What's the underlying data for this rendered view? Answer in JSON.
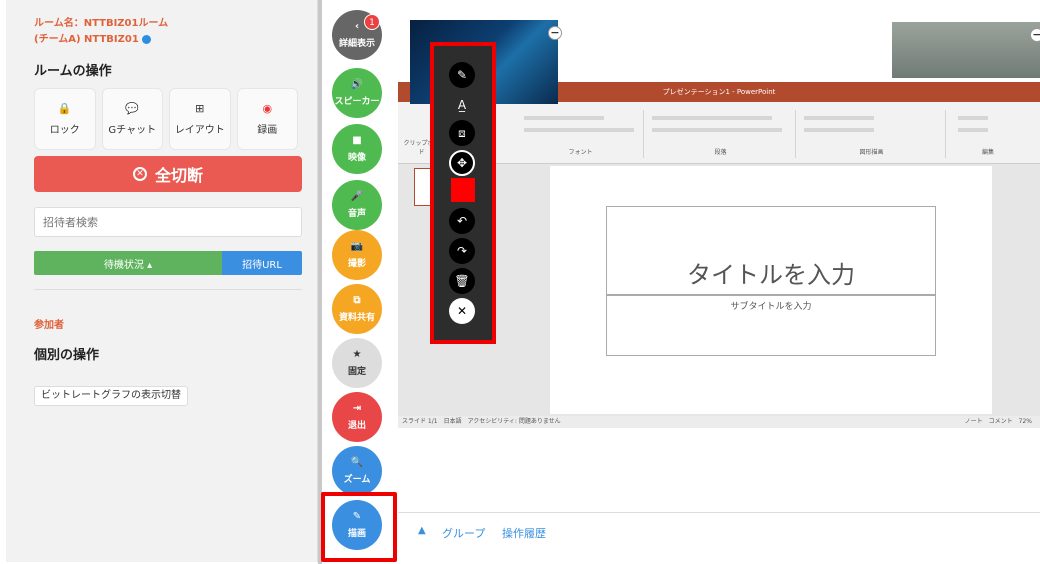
{
  "room": {
    "name_line1": "ルーム名：NTTBIZ01ルーム",
    "name_line2": "(チームA) NTTBIZ01",
    "ops_title": "ルームの操作",
    "ops": [
      {
        "icon": "lock-icon",
        "glyph": "🔒",
        "label": "ロック"
      },
      {
        "icon": "chat-icon",
        "glyph": "💬",
        "label": "Gチャット"
      },
      {
        "icon": "layout-icon",
        "glyph": "⊞",
        "label": "レイアウト"
      },
      {
        "icon": "record-icon",
        "glyph": "◉",
        "label": "録画"
      }
    ],
    "disconnect_label": "全切断",
    "search_placeholder": "招待者検索",
    "waiting_label": "待機状況 ▴",
    "invite_url_label": "招待URL",
    "participants_label": "参加者",
    "individual_ops_title": "個別の操作",
    "bitrate_toggle_label": "ビットレートグラフの表示切替"
  },
  "rail": {
    "badge_count": "1",
    "buttons": [
      {
        "name": "details",
        "icon": "chevron-left-icon",
        "glyph": "‹",
        "label": "詳細表示"
      },
      {
        "name": "speaker",
        "icon": "speaker-icon",
        "glyph": "🔊",
        "label": "スピーカー"
      },
      {
        "name": "video",
        "icon": "video-icon",
        "glyph": "■",
        "label": "映像"
      },
      {
        "name": "audio",
        "icon": "microphone-icon",
        "glyph": "🎤",
        "label": "音声"
      },
      {
        "name": "photo",
        "icon": "camera-icon",
        "glyph": "📷",
        "label": "撮影"
      },
      {
        "name": "share",
        "icon": "share-icon",
        "glyph": "⧉",
        "label": "資料共有"
      },
      {
        "name": "pin",
        "icon": "star-icon",
        "glyph": "★",
        "label": "固定"
      },
      {
        "name": "exit",
        "icon": "exit-icon",
        "glyph": "⇥",
        "label": "退出"
      },
      {
        "name": "zoom",
        "icon": "zoom-icon",
        "glyph": "🔍",
        "label": "ズーム"
      },
      {
        "name": "draw",
        "icon": "draw-icon",
        "glyph": "✎",
        "label": "描画"
      }
    ]
  },
  "ppt": {
    "window_title": "プレゼンテーション1 - PowerPoint",
    "ribbon_groups": [
      "クリップボード",
      "フォント",
      "段落",
      "図形描画",
      "編集"
    ],
    "slide_title": "タイトルを入力",
    "slide_subtitle": "サブタイトルを入力",
    "status_left": "スライド 1/1　日本語　アクセシビリティ: 問題ありません",
    "status_right": "ノート　コメント　72%",
    "thumb_index": "1"
  },
  "toolbar": {
    "tools": [
      {
        "name": "pen",
        "icon": "pencil-icon",
        "glyph": "✎"
      },
      {
        "name": "text",
        "icon": "text-icon",
        "glyph": "A̲"
      },
      {
        "name": "shapes",
        "icon": "shapes-icon",
        "glyph": "⧈"
      },
      {
        "name": "move",
        "icon": "move-icon",
        "glyph": "✥"
      },
      {
        "name": "undo",
        "icon": "undo-icon",
        "glyph": "↶"
      },
      {
        "name": "redo",
        "icon": "redo-icon",
        "glyph": "↷"
      },
      {
        "name": "delete",
        "icon": "trash-icon",
        "glyph": "🗑"
      },
      {
        "name": "close",
        "icon": "close-icon",
        "glyph": "✕"
      }
    ],
    "current_color": "#ff0000"
  },
  "bottom": {
    "group_label": "グループ",
    "history_label": "操作履歴"
  }
}
